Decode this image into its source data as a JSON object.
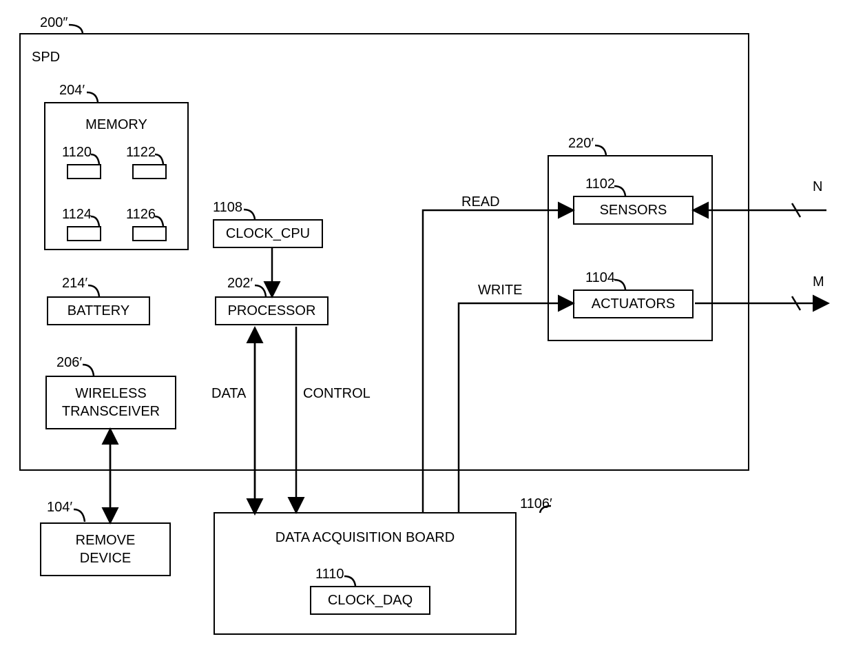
{
  "refs": {
    "spd_outer": "200″",
    "spd_label": "SPD",
    "memory_ref": "204′",
    "memory_label": "MEMORY",
    "mem_1120": "1120",
    "mem_1122": "1122",
    "mem_1124": "1124",
    "mem_1126": "1126",
    "clock_cpu_ref": "1108",
    "clock_cpu_label": "CLOCK_CPU",
    "battery_ref": "214′",
    "battery_label": "BATTERY",
    "processor_ref": "202′",
    "processor_label": "PROCESSOR",
    "wireless_ref": "206′",
    "wireless_label": "WIRELESS\nTRANSCEIVER",
    "remove_ref": "104′",
    "remove_label": "REMOVE\nDEVICE",
    "io_box_ref": "220′",
    "sensors_ref": "1102",
    "sensors_label": "SENSORS",
    "actuators_ref": "1104",
    "actuators_label": "ACTUATORS",
    "daq_ref": "1106′",
    "daq_label": "DATA ACQUISITION BOARD",
    "clock_daq_ref": "1110",
    "clock_daq_label": "CLOCK_DAQ",
    "read_label": "READ",
    "write_label": "WRITE",
    "data_label": "DATA",
    "control_label": "CONTROL",
    "n_label": "N",
    "m_label": "M"
  }
}
